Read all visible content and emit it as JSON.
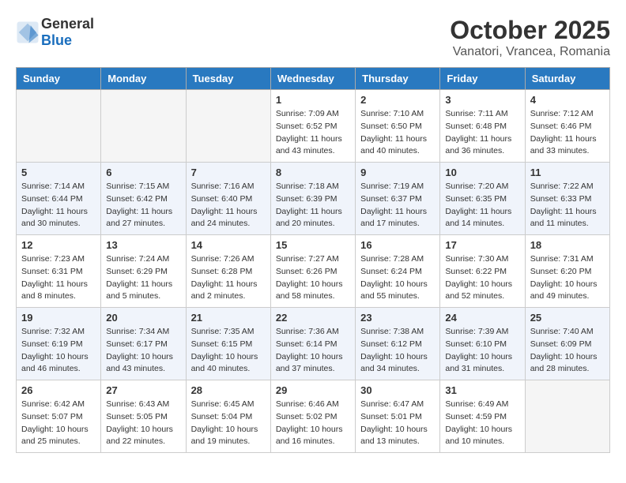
{
  "logo": {
    "general": "General",
    "blue": "Blue"
  },
  "header": {
    "month": "October 2025",
    "location": "Vanatori, Vrancea, Romania"
  },
  "weekdays": [
    "Sunday",
    "Monday",
    "Tuesday",
    "Wednesday",
    "Thursday",
    "Friday",
    "Saturday"
  ],
  "weeks": [
    [
      {
        "day": "",
        "empty": true
      },
      {
        "day": "",
        "empty": true
      },
      {
        "day": "",
        "empty": true
      },
      {
        "day": "1",
        "sunrise": "7:09 AM",
        "sunset": "6:52 PM",
        "daylight": "11 hours and 43 minutes."
      },
      {
        "day": "2",
        "sunrise": "7:10 AM",
        "sunset": "6:50 PM",
        "daylight": "11 hours and 40 minutes."
      },
      {
        "day": "3",
        "sunrise": "7:11 AM",
        "sunset": "6:48 PM",
        "daylight": "11 hours and 36 minutes."
      },
      {
        "day": "4",
        "sunrise": "7:12 AM",
        "sunset": "6:46 PM",
        "daylight": "11 hours and 33 minutes."
      }
    ],
    [
      {
        "day": "5",
        "sunrise": "7:14 AM",
        "sunset": "6:44 PM",
        "daylight": "11 hours and 30 minutes."
      },
      {
        "day": "6",
        "sunrise": "7:15 AM",
        "sunset": "6:42 PM",
        "daylight": "11 hours and 27 minutes."
      },
      {
        "day": "7",
        "sunrise": "7:16 AM",
        "sunset": "6:40 PM",
        "daylight": "11 hours and 24 minutes."
      },
      {
        "day": "8",
        "sunrise": "7:18 AM",
        "sunset": "6:39 PM",
        "daylight": "11 hours and 20 minutes."
      },
      {
        "day": "9",
        "sunrise": "7:19 AM",
        "sunset": "6:37 PM",
        "daylight": "11 hours and 17 minutes."
      },
      {
        "day": "10",
        "sunrise": "7:20 AM",
        "sunset": "6:35 PM",
        "daylight": "11 hours and 14 minutes."
      },
      {
        "day": "11",
        "sunrise": "7:22 AM",
        "sunset": "6:33 PM",
        "daylight": "11 hours and 11 minutes."
      }
    ],
    [
      {
        "day": "12",
        "sunrise": "7:23 AM",
        "sunset": "6:31 PM",
        "daylight": "11 hours and 8 minutes."
      },
      {
        "day": "13",
        "sunrise": "7:24 AM",
        "sunset": "6:29 PM",
        "daylight": "11 hours and 5 minutes."
      },
      {
        "day": "14",
        "sunrise": "7:26 AM",
        "sunset": "6:28 PM",
        "daylight": "11 hours and 2 minutes."
      },
      {
        "day": "15",
        "sunrise": "7:27 AM",
        "sunset": "6:26 PM",
        "daylight": "10 hours and 58 minutes."
      },
      {
        "day": "16",
        "sunrise": "7:28 AM",
        "sunset": "6:24 PM",
        "daylight": "10 hours and 55 minutes."
      },
      {
        "day": "17",
        "sunrise": "7:30 AM",
        "sunset": "6:22 PM",
        "daylight": "10 hours and 52 minutes."
      },
      {
        "day": "18",
        "sunrise": "7:31 AM",
        "sunset": "6:20 PM",
        "daylight": "10 hours and 49 minutes."
      }
    ],
    [
      {
        "day": "19",
        "sunrise": "7:32 AM",
        "sunset": "6:19 PM",
        "daylight": "10 hours and 46 minutes."
      },
      {
        "day": "20",
        "sunrise": "7:34 AM",
        "sunset": "6:17 PM",
        "daylight": "10 hours and 43 minutes."
      },
      {
        "day": "21",
        "sunrise": "7:35 AM",
        "sunset": "6:15 PM",
        "daylight": "10 hours and 40 minutes."
      },
      {
        "day": "22",
        "sunrise": "7:36 AM",
        "sunset": "6:14 PM",
        "daylight": "10 hours and 37 minutes."
      },
      {
        "day": "23",
        "sunrise": "7:38 AM",
        "sunset": "6:12 PM",
        "daylight": "10 hours and 34 minutes."
      },
      {
        "day": "24",
        "sunrise": "7:39 AM",
        "sunset": "6:10 PM",
        "daylight": "10 hours and 31 minutes."
      },
      {
        "day": "25",
        "sunrise": "7:40 AM",
        "sunset": "6:09 PM",
        "daylight": "10 hours and 28 minutes."
      }
    ],
    [
      {
        "day": "26",
        "sunrise": "6:42 AM",
        "sunset": "5:07 PM",
        "daylight": "10 hours and 25 minutes."
      },
      {
        "day": "27",
        "sunrise": "6:43 AM",
        "sunset": "5:05 PM",
        "daylight": "10 hours and 22 minutes."
      },
      {
        "day": "28",
        "sunrise": "6:45 AM",
        "sunset": "5:04 PM",
        "daylight": "10 hours and 19 minutes."
      },
      {
        "day": "29",
        "sunrise": "6:46 AM",
        "sunset": "5:02 PM",
        "daylight": "10 hours and 16 minutes."
      },
      {
        "day": "30",
        "sunrise": "6:47 AM",
        "sunset": "5:01 PM",
        "daylight": "10 hours and 13 minutes."
      },
      {
        "day": "31",
        "sunrise": "6:49 AM",
        "sunset": "4:59 PM",
        "daylight": "10 hours and 10 minutes."
      },
      {
        "day": "",
        "empty": true
      }
    ]
  ]
}
